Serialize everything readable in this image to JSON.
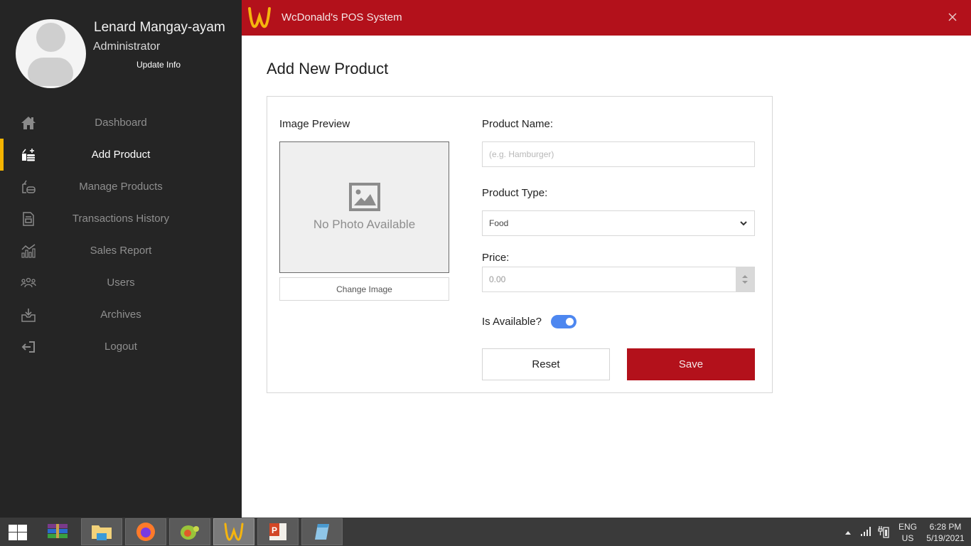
{
  "app": {
    "title": "WcDonald's POS System",
    "brand_color": "#b3111b",
    "accent_color": "#f4b400",
    "close_icon": "close-icon"
  },
  "user": {
    "name": "Lenard Mangay-ayam",
    "role": "Administrator",
    "update_link": "Update Info"
  },
  "sidebar": {
    "items": [
      {
        "label": "Dashboard",
        "icon": "home-icon",
        "active": false
      },
      {
        "label": "Add Product",
        "icon": "add-product-icon",
        "active": true
      },
      {
        "label": "Manage Products",
        "icon": "manage-products-icon",
        "active": false
      },
      {
        "label": "Transactions History",
        "icon": "receipt-icon",
        "active": false
      },
      {
        "label": "Sales Report",
        "icon": "chart-icon",
        "active": false
      },
      {
        "label": "Users",
        "icon": "users-icon",
        "active": false
      },
      {
        "label": "Archives",
        "icon": "archive-icon",
        "active": false
      },
      {
        "label": "Logout",
        "icon": "logout-icon",
        "active": false
      }
    ]
  },
  "main": {
    "page_title": "Add New Product",
    "image_preview": {
      "label": "Image Preview",
      "empty_text": "No Photo Available",
      "change_button": "Change Image"
    },
    "form": {
      "product_name_label": "Product Name:",
      "product_name_value": "",
      "product_name_placeholder": "(e.g. Hamburger)",
      "product_type_label": "Product Type:",
      "product_type_value": "Food",
      "price_label": "Price:",
      "price_value": "0.00",
      "available_label": "Is Available?",
      "available_value": true,
      "reset_button": "Reset",
      "save_button": "Save"
    }
  },
  "taskbar": {
    "apps": [
      {
        "name": "winrar",
        "pinned": false
      },
      {
        "name": "file-explorer",
        "pinned": true
      },
      {
        "name": "firefox",
        "pinned": true
      },
      {
        "name": "cygwin",
        "pinned": true
      },
      {
        "name": "wcdonalds-pos",
        "pinned": true,
        "current": true
      },
      {
        "name": "powerpoint",
        "pinned": true
      },
      {
        "name": "notepad",
        "pinned": true
      }
    ],
    "language_line1": "ENG",
    "language_line2": "US",
    "time": "6:28 PM",
    "date": "5/19/2021"
  }
}
